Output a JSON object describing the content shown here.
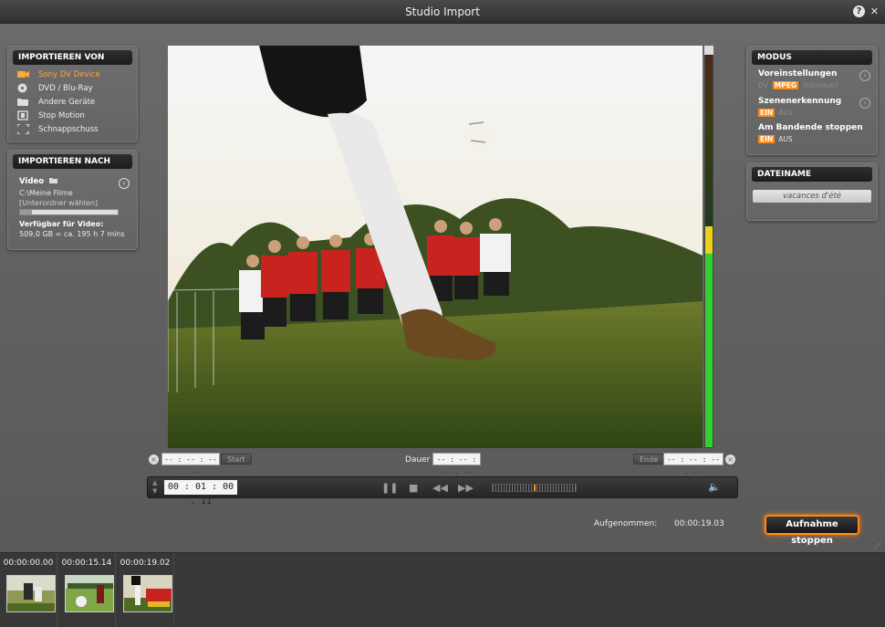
{
  "window": {
    "title": "Studio Import",
    "help_icon": "?",
    "close_icon": "✕"
  },
  "import_from": {
    "heading": "IMPORTIEREN VON",
    "items": [
      {
        "label": "Sony DV Device",
        "icon": "dv-camera-icon",
        "selected": true
      },
      {
        "label": "DVD / Blu-Ray",
        "icon": "disc-icon",
        "selected": false
      },
      {
        "label": "Andere Geräte",
        "icon": "folder-icon",
        "selected": false
      },
      {
        "label": "Stop Motion",
        "icon": "stop-motion-icon",
        "selected": false
      },
      {
        "label": "Schnappschuss",
        "icon": "snapshot-icon",
        "selected": false
      }
    ]
  },
  "import_to": {
    "heading": "IMPORTIEREN NACH",
    "video_label": "Video",
    "path": "C:\\Meine Filme",
    "subfolder": "[Unterordner wählen]",
    "disk_usage_fraction": 0.12,
    "available_label": "Verfügbar für Video:",
    "available_value": "509,0 GB = ca. 195 h 7 mins"
  },
  "mode": {
    "heading": "MODUS",
    "presets_label": "Voreinstellungen",
    "presets_options": [
      "DV",
      "MPEG",
      "Individuell"
    ],
    "presets_selected": "MPEG",
    "scene_label": "Szenenerkennung",
    "scene_options": [
      "EIN",
      "AUS"
    ],
    "scene_selected": "EIN",
    "tape_end_label": "Am Bandende stoppen",
    "tape_end_options": [
      "EIN",
      "AUS"
    ],
    "tape_end_selected": "EIN"
  },
  "filename": {
    "heading": "DATEINAME",
    "value": "vacances d'été"
  },
  "marks": {
    "start_tc": "-- : -- : -- . --",
    "start_btn": "Start",
    "duration_label": "Dauer",
    "duration_tc": "-- : -- : -- . --",
    "end_btn": "Ende",
    "end_tc": "-- : -- : -- . --"
  },
  "transport": {
    "timecode": "00 : 01 : 00 . 11"
  },
  "recorded": {
    "label": "Aufgenommen:",
    "value": "00:00:19.03"
  },
  "stop_button": "Aufnahme stoppen",
  "clips": [
    {
      "time": "00:00:00.00"
    },
    {
      "time": "00:00:15.14"
    },
    {
      "time": "00:00:19.02"
    }
  ],
  "colors": {
    "accent": "#ff8a1a",
    "selected_text": "#ffa53a",
    "vu_green": "#2fd22f",
    "vu_yellow": "#e8d21a"
  }
}
